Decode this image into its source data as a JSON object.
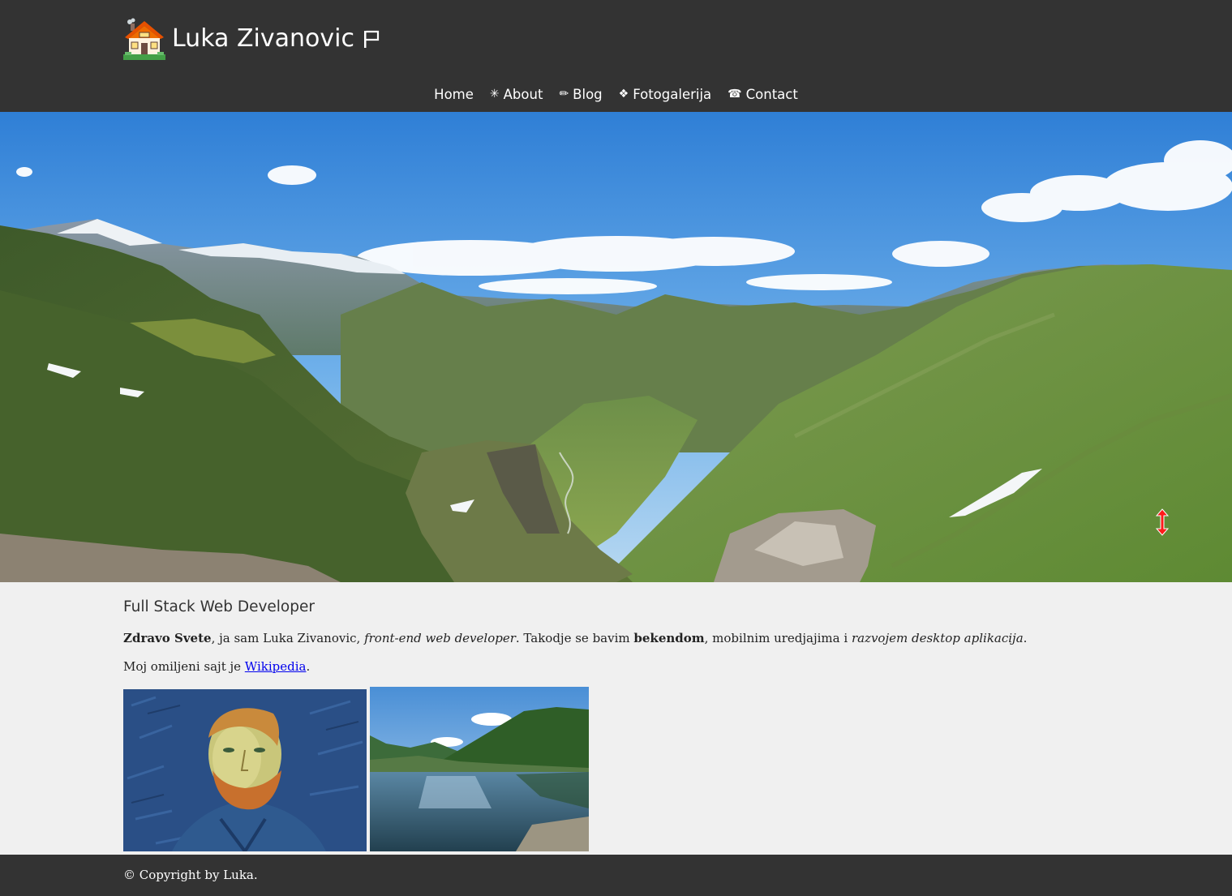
{
  "header": {
    "site_title": "Luka Zivanovic",
    "logo_icon": "house-icon",
    "title_icon": "flag-icon",
    "background_color": "#333333"
  },
  "nav": {
    "items": [
      {
        "glyph": "",
        "label": "Home"
      },
      {
        "glyph": "✳",
        "label": "About"
      },
      {
        "glyph": "✏",
        "label": "Blog"
      },
      {
        "glyph": "❖",
        "label": "Fotogalerija"
      },
      {
        "glyph": "☎",
        "label": "Contact"
      }
    ]
  },
  "main": {
    "heading": "Full Stack Web Developer",
    "intro": {
      "greeting": "Zdravo Svete",
      "part1": ", ja sam Luka Zivanovic, ",
      "role": "front-end web developer",
      "part2": ". Takodje se bavim ",
      "backend": "bekendom",
      "part3": ", mobilnim uredjajima i ",
      "desktop": "razvojem desktop aplikacija",
      "part4": "."
    },
    "favorite": {
      "prefix": "Moj omiljeni sajt je ",
      "link_text": "Wikipedia",
      "suffix": "."
    }
  },
  "footer": {
    "copyright": "© Copyright by Luka."
  },
  "colors": {
    "header_bg": "#333333",
    "page_bg": "#f0f0f0",
    "link": "#0000ee"
  }
}
